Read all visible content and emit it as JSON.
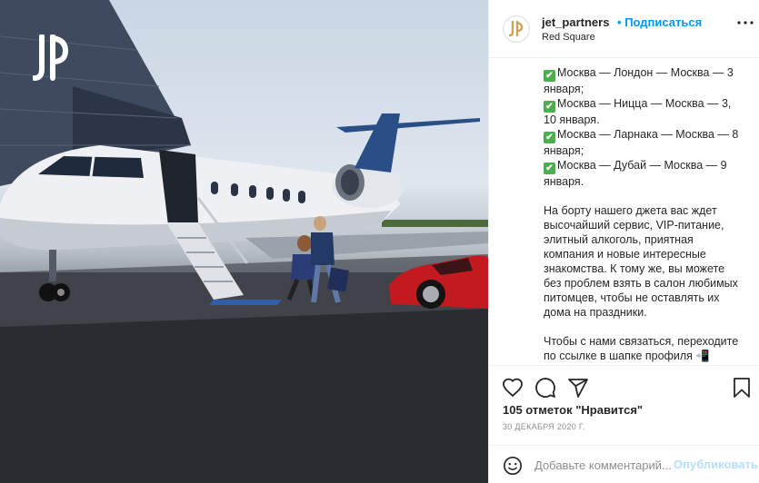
{
  "post": {
    "photo_alt": "Private jet with passengers on tarmac",
    "logo_letters": "JP"
  },
  "header": {
    "username": "jet_partners",
    "separator": "•",
    "follow_label": "Подписаться",
    "location": "Red Square"
  },
  "caption": {
    "routes": [
      "Москва — Лондон — Москва — 3 января;",
      "Москва — Ницца — Москва — 3, 10 января.",
      "Москва — Ларнака — Москва — 8 января;",
      "Москва — Дубай — Москва — 9 января."
    ],
    "check_glyph": "✔",
    "body": "На борту нашего джета вас ждет высочайший сервис, VIP-питание, элитный алкоголь, приятная компания и новые интересные знакомства. К тому же, вы можете без проблем взять в салон любимых питомцев, чтобы не оставлять их дома на праздники.",
    "contact": "Чтобы с нами связаться, переходите по ссылке в шапке профиля 📲"
  },
  "actions": {
    "like_icon": "heart-icon",
    "comment_icon": "comment-icon",
    "share_icon": "share-icon",
    "save_icon": "bookmark-icon"
  },
  "likes": "105 отметок \"Нравится\"",
  "date": "30 ДЕКАБРЯ 2020 Г.",
  "comment_box": {
    "placeholder": "Добавьте комментарий...",
    "publish_label": "Опубликовать"
  },
  "colors": {
    "accent": "#0095f6",
    "publish_disabled": "#b2dffc",
    "check_green": "#4cae4f"
  }
}
